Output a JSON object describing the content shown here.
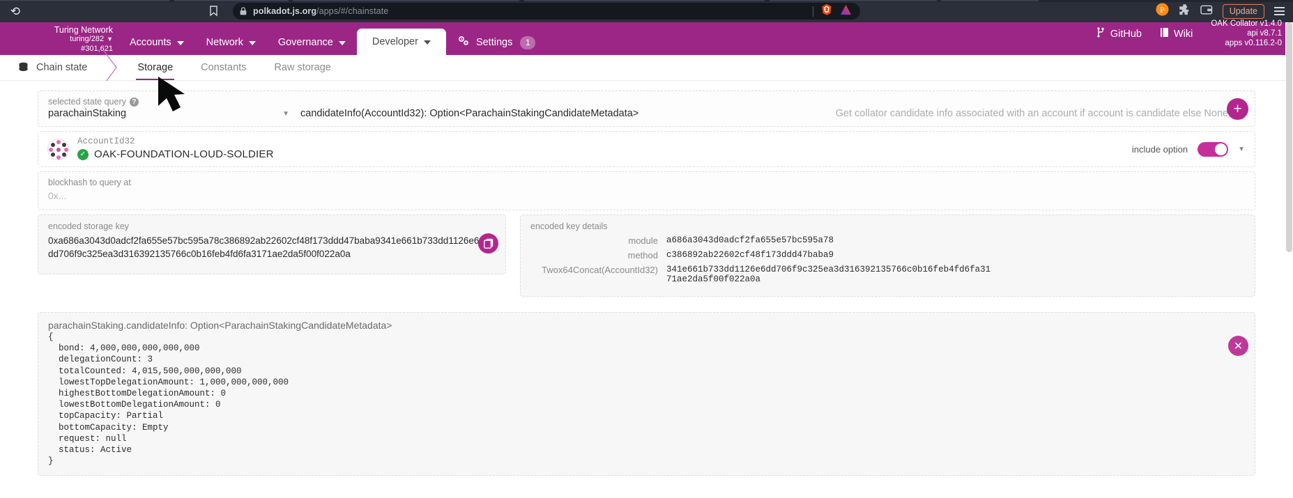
{
  "browser": {
    "reload_icon": "reload-icon",
    "bookmark_icon": "bookmark-icon",
    "lock_icon": "lock-icon",
    "url_domain": "polkadot.js.org",
    "url_path": "/apps/#/chainstate",
    "brave_shield_icon": "brave-lion-icon",
    "brave_leo_icon": "brave-leo-icon",
    "extension_icons": [
      "polkadot-extension-icon",
      "puzzle-extension-icon",
      "wallet-icon"
    ],
    "update_label": "Update",
    "menu_icon": "hamburger-menu-icon"
  },
  "topnav": {
    "chain": {
      "name": "Turing Network",
      "node": "turing/282",
      "block": "#301,621"
    },
    "items": [
      {
        "label": "Accounts",
        "has_caret": true,
        "active": false
      },
      {
        "label": "Network",
        "has_caret": true,
        "active": false
      },
      {
        "label": "Governance",
        "has_caret": true,
        "active": false
      },
      {
        "label": "Developer",
        "has_caret": true,
        "active": true
      },
      {
        "label": "Settings",
        "has_caret": false,
        "active": false,
        "badge": "1",
        "icon": "gears-icon"
      }
    ],
    "links": [
      {
        "label": "GitHub",
        "icon": "git-branch-icon"
      },
      {
        "label": "Wiki",
        "icon": "book-icon"
      }
    ],
    "version": {
      "collator": "OAK Collator v1.4.0",
      "api": "api v8.7.1",
      "apps": "apps v0.116.2-0"
    }
  },
  "tabrow": {
    "section": "Chain state",
    "section_icon": "database-icon",
    "tabs": [
      {
        "label": "Storage",
        "active": true
      },
      {
        "label": "Constants",
        "active": false
      },
      {
        "label": "Raw storage",
        "active": false
      }
    ]
  },
  "query": {
    "label": "selected state query",
    "help_icon": "help-circle-icon",
    "module": "parachainStaking",
    "method": "candidateInfo(AccountId32): Option<ParachainStakingCandidateMetadata>",
    "hint": "Get collator candidate info associated with an account if account is candidate else None",
    "add_button_icon": "plus-icon"
  },
  "account": {
    "type_label": "AccountId32",
    "name": "OAK-FOUNDATION-LOUD-SOLDIER",
    "verified_icon": "check-circle-icon",
    "identicon": "polkadot-identicon",
    "include_option_label": "include option",
    "include_option_on": true
  },
  "blockhash": {
    "label": "blockhash to query at",
    "placeholder": "0x..."
  },
  "encoded_key": {
    "label": "encoded storage key",
    "value": "0xa686a3043d0adcf2fa655e57bc595a78c386892ab22602cf48f173ddd47baba9341e661b733dd1126e6dd706f9c325ea3d316392135766c0b16feb4fd6fa3171ae2da5f00f022a0a",
    "copy_icon": "copy-icon"
  },
  "key_details": {
    "label": "encoded key details",
    "rows": [
      {
        "key": "module",
        "value": "a686a3043d0adcf2fa655e57bc595a78"
      },
      {
        "key": "method",
        "value": "c386892ab22602cf48f173ddd47baba9"
      },
      {
        "key": "Twox64Concat(AccountId32)",
        "value": "341e661b733dd1126e6dd706f9c325ea3d316392135766c0b16feb4fd6fa3171ae2da5f00f022a0a"
      }
    ]
  },
  "result": {
    "header": "parachainStaking.candidateInfo: Option<ParachainStakingCandidateMetadata>",
    "body": "{\n  bond: 4,000,000,000,000,000\n  delegationCount: 3\n  totalCounted: 4,015,500,000,000,000\n  lowestTopDelegationAmount: 1,000,000,000,000\n  highestBottomDelegationAmount: 0\n  lowestBottomDelegationAmount: 0\n  topCapacity: Partial\n  bottomCapacity: Empty\n  request: null\n  status: Active\n}",
    "close_icon": "close-icon"
  },
  "colors": {
    "brand": "#9c2686",
    "accent": "#b4258f",
    "toggle_on": "#c62f9b",
    "success": "#28a445",
    "browser_bg": "#2b2f3a"
  }
}
